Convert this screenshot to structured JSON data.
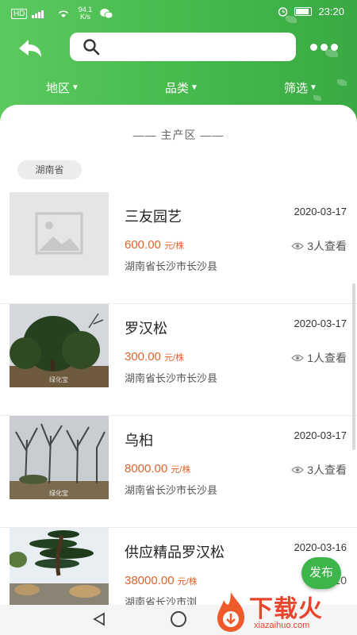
{
  "status_bar": {
    "network_label": "HD",
    "speed": "94.1 K/s",
    "time": "23:20"
  },
  "search": {
    "value": "",
    "placeholder": ""
  },
  "filters": [
    {
      "label": "地区"
    },
    {
      "label": "品类"
    },
    {
      "label": "筛选"
    }
  ],
  "section_title": "—— 主产区 ——",
  "province_tag": "湖南省",
  "listings": [
    {
      "title": "三友园艺",
      "date": "2020-03-17",
      "price": "600.00",
      "unit": "元/株",
      "views": "3人查看",
      "location": "湖南省长沙市长沙县",
      "image": "placeholder-image-icon"
    },
    {
      "title": "罗汉松",
      "date": "2020-03-17",
      "price": "300.00",
      "unit": "元/株",
      "views": "1人查看",
      "location": "湖南省长沙市长沙县",
      "image": "tree-photo",
      "image_caption": "绿化宝"
    },
    {
      "title": "乌桕",
      "date": "2020-03-17",
      "price": "8000.00",
      "unit": "元/株",
      "views": "3人查看",
      "location": "湖南省长沙市长沙县",
      "image": "tree-photo",
      "image_caption": "绿化宝"
    },
    {
      "title": "供应精品罗汉松",
      "date": "2020-03-16",
      "price": "38000.00",
      "unit": "元/株",
      "views": "10",
      "location": "湖南省长沙市浏",
      "image": "bonsai-photo"
    }
  ],
  "publish_button": "发布",
  "watermark": {
    "text": "下载火",
    "url": "xiazaihuo.com"
  },
  "colors": {
    "primary_green": "#45b94b",
    "price_orange": "#e2632a"
  }
}
